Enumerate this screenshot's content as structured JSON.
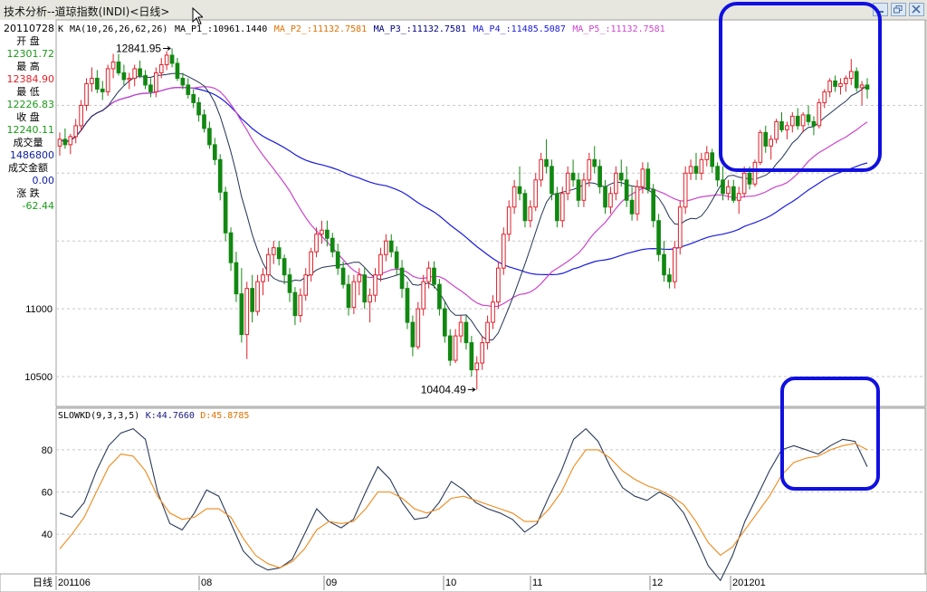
{
  "window": {
    "title": "技术分析--道琼指数(INDI)<日线>",
    "buttons": [
      "minimize",
      "restore",
      "close"
    ]
  },
  "info_panel": {
    "date": "20110728",
    "rows": [
      {
        "label": "开  盘",
        "value": "12301.72",
        "color": "#1a9a1a"
      },
      {
        "label": "最  高",
        "value": "12384.90",
        "color": "#e0202a"
      },
      {
        "label": "最  低",
        "value": "12226.83",
        "color": "#1a9a1a"
      },
      {
        "label": "收  盘",
        "value": "12240.11",
        "color": "#1a9a1a"
      },
      {
        "label": "成交量",
        "value": "1486800",
        "color": "#1020a0"
      },
      {
        "label": "成交金额",
        "value": "0.00",
        "color": "#1020a0"
      },
      {
        "label": "涨  跌",
        "value": "-62.44",
        "color": "#1a9a1a"
      }
    ]
  },
  "main_chart": {
    "header": [
      {
        "text": "K",
        "color": "#000000"
      },
      {
        "text": "MA(10,26,26,62,26)",
        "color": "#000000"
      },
      {
        "text": "MA_P1_:10961.1440",
        "color": "#000000"
      },
      {
        "text": "MA_P2_:11132.7581",
        "color": "#e07000"
      },
      {
        "text": "MA_P3_:11132.7581",
        "color": "#000080"
      },
      {
        "text": "MA_P4_:11485.5087",
        "color": "#1a1ae0"
      },
      {
        "text": "MA_P5_:11132.7581",
        "color": "#cc44cc"
      }
    ],
    "y_ticks": [
      "11000",
      "10500"
    ],
    "annotation_high": "12841.95",
    "annotation_low": "10404.49"
  },
  "oscillator": {
    "header": [
      {
        "text": "SLOWKD(9,3,3,5)",
        "color": "#000000"
      },
      {
        "text": "K:44.7660",
        "color": "#1a1a80"
      },
      {
        "text": "D:45.8785",
        "color": "#e07000"
      }
    ],
    "y_ticks": [
      "80",
      "60",
      "40"
    ]
  },
  "x_axis": {
    "corner_label": "日线",
    "labels": [
      "201106",
      "08",
      "09",
      "10",
      "11",
      "12",
      "201201"
    ]
  },
  "chart_data": [
    {
      "type": "candlestick",
      "title": "",
      "ylim": [
        10300,
        13050
      ],
      "y_ticks": [
        11000,
        10500
      ],
      "candles": [
        [
          12200,
          12300,
          12130,
          12250
        ],
        [
          12250,
          12330,
          12180,
          12210
        ],
        [
          12210,
          12290,
          12140,
          12270
        ],
        [
          12270,
          12400,
          12220,
          12350
        ],
        [
          12350,
          12540,
          12310,
          12500
        ],
        [
          12500,
          12700,
          12460,
          12660
        ],
        [
          12660,
          12780,
          12600,
          12700
        ],
        [
          12700,
          12760,
          12590,
          12620
        ],
        [
          12620,
          12680,
          12540,
          12600
        ],
        [
          12600,
          12800,
          12570,
          12770
        ],
        [
          12770,
          12880,
          12700,
          12820
        ],
        [
          12820,
          12880,
          12720,
          12740
        ],
        [
          12740,
          12800,
          12650,
          12690
        ],
        [
          12690,
          12740,
          12620,
          12700
        ],
        [
          12700,
          12800,
          12640,
          12770
        ],
        [
          12770,
          12830,
          12700,
          12720
        ],
        [
          12720,
          12760,
          12620,
          12650
        ],
        [
          12650,
          12700,
          12560,
          12600
        ],
        [
          12600,
          12780,
          12560,
          12740
        ],
        [
          12740,
          12850,
          12700,
          12800
        ],
        [
          12800,
          12900,
          12760,
          12870
        ],
        [
          12870,
          12920,
          12780,
          12810
        ],
        [
          12810,
          12850,
          12680,
          12700
        ],
        [
          12700,
          12740,
          12620,
          12650
        ],
        [
          12650,
          12700,
          12550,
          12580
        ],
        [
          12580,
          12620,
          12480,
          12520
        ],
        [
          12520,
          12560,
          12380,
          12430
        ],
        [
          12430,
          12470,
          12300,
          12330
        ],
        [
          12330,
          12380,
          12180,
          12210
        ],
        [
          12210,
          12260,
          12060,
          12100
        ],
        [
          12100,
          12140,
          11800,
          11860
        ],
        [
          11860,
          11900,
          11500,
          11560
        ],
        [
          11560,
          11600,
          11280,
          11340
        ],
        [
          11340,
          11420,
          11050,
          11110
        ],
        [
          11110,
          11300,
          10750,
          10810
        ],
        [
          10810,
          11200,
          10630,
          11150
        ],
        [
          11150,
          11250,
          10900,
          10980
        ],
        [
          10980,
          11250,
          10950,
          11200
        ],
        [
          11200,
          11300,
          11100,
          11250
        ],
        [
          11250,
          11450,
          11200,
          11400
        ],
        [
          11400,
          11500,
          11330,
          11450
        ],
        [
          11450,
          11500,
          11320,
          11370
        ],
        [
          11370,
          11400,
          11180,
          11250
        ],
        [
          11250,
          11300,
          11050,
          11120
        ],
        [
          11120,
          11160,
          10880,
          10950
        ],
        [
          10950,
          11150,
          10900,
          11100
        ],
        [
          11100,
          11300,
          11060,
          11250
        ],
        [
          11250,
          11450,
          11200,
          11420
        ],
        [
          11420,
          11600,
          11380,
          11550
        ],
        [
          11550,
          11650,
          11480,
          11580
        ],
        [
          11580,
          11650,
          11460,
          11520
        ],
        [
          11520,
          11560,
          11380,
          11420
        ],
        [
          11420,
          11480,
          11250,
          11300
        ],
        [
          11300,
          11350,
          11150,
          11180
        ],
        [
          11180,
          11250,
          10950,
          11010
        ],
        [
          11010,
          11250,
          10960,
          11200
        ],
        [
          11200,
          11300,
          11100,
          11250
        ],
        [
          11250,
          11300,
          11000,
          11050
        ],
        [
          11050,
          11150,
          10900,
          11100
        ],
        [
          11100,
          11300,
          11050,
          11250
        ],
        [
          11250,
          11450,
          11200,
          11400
        ],
        [
          11400,
          11550,
          11350,
          11500
        ],
        [
          11500,
          11550,
          11380,
          11420
        ],
        [
          11420,
          11460,
          11250,
          11300
        ],
        [
          11300,
          11360,
          11080,
          11150
        ],
        [
          11150,
          11200,
          10850,
          10900
        ],
        [
          10900,
          10950,
          10650,
          10720
        ],
        [
          10720,
          11050,
          10700,
          11000
        ],
        [
          11000,
          11250,
          10950,
          11200
        ],
        [
          11200,
          11350,
          11150,
          11300
        ],
        [
          11300,
          11350,
          11150,
          11180
        ],
        [
          11180,
          11220,
          10950,
          11000
        ],
        [
          11000,
          11050,
          10750,
          10800
        ],
        [
          10800,
          10850,
          10580,
          10620
        ],
        [
          10620,
          10850,
          10600,
          10800
        ],
        [
          10800,
          10950,
          10750,
          10900
        ],
        [
          10900,
          10950,
          10700,
          10750
        ],
        [
          10750,
          10800,
          10500,
          10550
        ],
        [
          10550,
          10650,
          10404,
          10600
        ],
        [
          10600,
          10800,
          10550,
          10750
        ],
        [
          10750,
          10950,
          10700,
          10900
        ],
        [
          10900,
          11100,
          10850,
          11050
        ],
        [
          11050,
          11350,
          11000,
          11300
        ],
        [
          11300,
          11600,
          11250,
          11550
        ],
        [
          11550,
          11800,
          11500,
          11750
        ],
        [
          11750,
          11950,
          11700,
          11900
        ],
        [
          11900,
          12050,
          11800,
          11850
        ],
        [
          11850,
          11880,
          11600,
          11650
        ],
        [
          11650,
          11800,
          11600,
          11750
        ],
        [
          11750,
          12000,
          11720,
          11950
        ],
        [
          11950,
          12150,
          11900,
          12100
        ],
        [
          12100,
          12250,
          12000,
          12050
        ],
        [
          12050,
          12100,
          11800,
          11850
        ],
        [
          11850,
          11900,
          11600,
          11650
        ],
        [
          11650,
          11900,
          11600,
          11850
        ],
        [
          11850,
          12050,
          11800,
          12000
        ],
        [
          12000,
          12100,
          11900,
          11950
        ],
        [
          11950,
          12000,
          11750,
          11800
        ],
        [
          11800,
          12000,
          11750,
          11950
        ],
        [
          11950,
          12150,
          11900,
          12100
        ],
        [
          12100,
          12200,
          12000,
          12050
        ],
        [
          12050,
          12100,
          11850,
          11900
        ],
        [
          11900,
          11950,
          11700,
          11750
        ],
        [
          11750,
          11900,
          11700,
          11850
        ],
        [
          11850,
          12050,
          11800,
          12000
        ],
        [
          12000,
          12100,
          11900,
          11950
        ],
        [
          11950,
          12050,
          11750,
          11800
        ],
        [
          11800,
          11900,
          11650,
          11700
        ],
        [
          11700,
          11950,
          11650,
          11900
        ],
        [
          11900,
          12080,
          11850,
          12030
        ],
        [
          12030,
          12080,
          11850,
          11880
        ],
        [
          11880,
          11920,
          11600,
          11650
        ],
        [
          11650,
          11700,
          11350,
          11400
        ],
        [
          11400,
          11500,
          11200,
          11250
        ],
        [
          11250,
          11300,
          11150,
          11200
        ],
        [
          11200,
          11500,
          11150,
          11450
        ],
        [
          11450,
          11800,
          11400,
          11750
        ],
        [
          11750,
          12050,
          11700,
          12000
        ],
        [
          12000,
          12100,
          11950,
          12050
        ],
        [
          12050,
          12150,
          11950,
          12000
        ],
        [
          12000,
          12150,
          11950,
          12100
        ],
        [
          12100,
          12200,
          12050,
          12150
        ],
        [
          12150,
          12180,
          12000,
          12050
        ],
        [
          12050,
          12080,
          11900,
          11950
        ],
        [
          11950,
          12050,
          11800,
          11850
        ],
        [
          11850,
          11950,
          11800,
          11900
        ],
        [
          11900,
          11950,
          11780,
          11800
        ],
        [
          11800,
          11900,
          11700,
          11850
        ],
        [
          11850,
          12050,
          11820,
          12000
        ],
        [
          12000,
          12050,
          11880,
          11920
        ],
        [
          11920,
          12100,
          11900,
          12080
        ],
        [
          12080,
          12320,
          12060,
          12300
        ],
        [
          12300,
          12350,
          12150,
          12200
        ],
        [
          12200,
          12280,
          12100,
          12250
        ],
        [
          12250,
          12400,
          12220,
          12380
        ],
        [
          12380,
          12450,
          12300,
          12320
        ],
        [
          12320,
          12380,
          12250,
          12350
        ],
        [
          12350,
          12450,
          12300,
          12420
        ],
        [
          12420,
          12480,
          12320,
          12350
        ],
        [
          12350,
          12450,
          12300,
          12430
        ],
        [
          12430,
          12500,
          12350,
          12380
        ],
        [
          12380,
          12420,
          12280,
          12350
        ],
        [
          12350,
          12550,
          12330,
          12520
        ],
        [
          12520,
          12620,
          12480,
          12600
        ],
        [
          12600,
          12700,
          12560,
          12680
        ],
        [
          12680,
          12720,
          12600,
          12640
        ],
        [
          12640,
          12700,
          12580,
          12660
        ],
        [
          12660,
          12720,
          12600,
          12700
        ],
        [
          12700,
          12842,
          12650,
          12750
        ],
        [
          12750,
          12780,
          12600,
          12630
        ],
        [
          12630,
          12680,
          12500,
          12650
        ],
        [
          12650,
          12700,
          12550,
          12620
        ]
      ],
      "ma_fast_endpoint": 10961.144
    },
    {
      "type": "line",
      "title": "",
      "ylim": [
        22,
        95
      ],
      "y_ticks": [
        80,
        60,
        40
      ],
      "series": [
        {
          "name": "K",
          "values": [
            50,
            48,
            55,
            70,
            82,
            88,
            90,
            85,
            60,
            45,
            42,
            50,
            61,
            58,
            45,
            32,
            26,
            23,
            24,
            28,
            40,
            52,
            46,
            43,
            47,
            60,
            72,
            66,
            55,
            47,
            48,
            55,
            65,
            61,
            55,
            52,
            50,
            47,
            41,
            45,
            58,
            70,
            85,
            90,
            84,
            72,
            62,
            58,
            56,
            60,
            57,
            50,
            38,
            25,
            18,
            30,
            46,
            58,
            70,
            80,
            82,
            80,
            78,
            82,
            85,
            84,
            72
          ]
        },
        {
          "name": "D",
          "values": [
            33,
            40,
            48,
            60,
            72,
            78,
            77,
            70,
            58,
            50,
            47,
            48,
            52,
            52,
            48,
            38,
            30,
            26,
            24,
            27,
            33,
            42,
            46,
            45,
            46,
            52,
            60,
            60,
            57,
            52,
            50,
            52,
            57,
            58,
            56,
            54,
            52,
            50,
            46,
            46,
            52,
            60,
            72,
            80,
            80,
            76,
            70,
            66,
            63,
            61,
            58,
            54,
            46,
            36,
            30,
            34,
            42,
            50,
            58,
            68,
            74,
            76,
            77,
            80,
            82,
            83,
            80
          ]
        }
      ]
    }
  ]
}
